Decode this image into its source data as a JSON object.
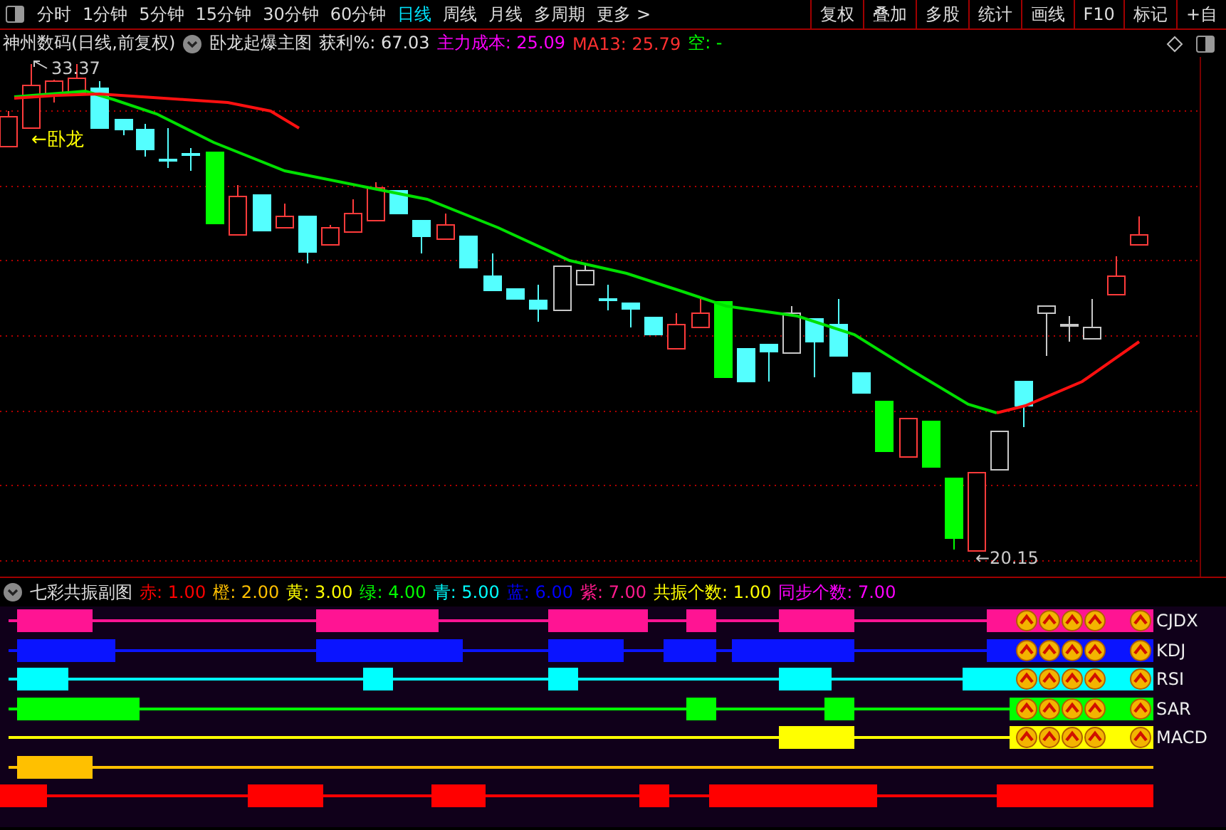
{
  "toolbar": {
    "periods": [
      {
        "label": "分时",
        "selected": false
      },
      {
        "label": "1分钟",
        "selected": false
      },
      {
        "label": "5分钟",
        "selected": false
      },
      {
        "label": "15分钟",
        "selected": false
      },
      {
        "label": "30分钟",
        "selected": false
      },
      {
        "label": "60分钟",
        "selected": false
      },
      {
        "label": "日线",
        "selected": true
      },
      {
        "label": "周线",
        "selected": false
      },
      {
        "label": "月线",
        "selected": false
      },
      {
        "label": "多周期",
        "selected": false
      },
      {
        "label": "更多 >",
        "selected": false
      }
    ],
    "buttons": [
      "复权",
      "叠加",
      "多股",
      "统计",
      "画线",
      "F10",
      "标记",
      "+自"
    ]
  },
  "main_chart": {
    "title": "神州数码(日线,前复权)",
    "indicator": "卧龙起爆主图",
    "fields": [
      {
        "text": "获利%: 67.03",
        "color": "#e0e0e0"
      },
      {
        "text": "主力成本: 25.09",
        "color": "#ff00ff"
      },
      {
        "text": "MA13: 25.79",
        "color": "#ff3030"
      },
      {
        "text": "空: -",
        "color": "#00ff00"
      }
    ],
    "high_label": "33.37",
    "low_label": "←20.15",
    "signal_label": "←卧龙"
  },
  "sub_chart": {
    "title": "七彩共振副图",
    "params": [
      {
        "text": "赤: 1.00",
        "color": "#ff0000"
      },
      {
        "text": "橙: 2.00",
        "color": "#ffc000"
      },
      {
        "text": "黄: 3.00",
        "color": "#ffff00"
      },
      {
        "text": "绿: 4.00",
        "color": "#00ff00"
      },
      {
        "text": "青: 5.00",
        "color": "#00ffff"
      },
      {
        "text": "蓝: 6.00",
        "color": "#0000ff"
      },
      {
        "text": "紫: 7.00",
        "color": "#ff1a8c"
      },
      {
        "text": "共振个数: 1.00",
        "color": "#ffff00"
      },
      {
        "text": "同步个数: 7.00",
        "color": "#ff00ff"
      }
    ],
    "rows": [
      {
        "label": "CJDX",
        "color": "#ff1493"
      },
      {
        "label": "KDJ",
        "color": "#0a14ff"
      },
      {
        "label": "RSI",
        "color": "#00ffff"
      },
      {
        "label": "SAR",
        "color": "#00ff00"
      },
      {
        "label": "MACD",
        "color": "#ffff00"
      },
      {
        "color": "#ffc000"
      },
      {
        "color": "#ff0000"
      }
    ]
  }
}
